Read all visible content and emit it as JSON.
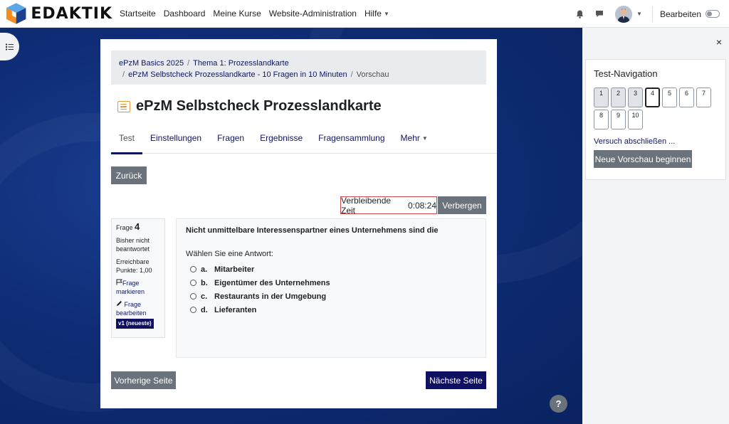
{
  "brand": {
    "name": "EDAKTIK"
  },
  "topnav": {
    "items": [
      "Startseite",
      "Dashboard",
      "Meine Kurse",
      "Website-Administration"
    ],
    "help": "Hilfe",
    "edit_label": "Bearbeiten"
  },
  "breadcrumb": {
    "items": [
      "ePzM Basics 2025",
      "Thema 1: Prozesslandkarte",
      "ePzM Selbstcheck Prozesslandkarte - 10 Fragen in 10 Minuten"
    ],
    "current": "Vorschau"
  },
  "page_title": "ePzM Selbstcheck Prozesslandkarte",
  "tabs": [
    "Test",
    "Einstellungen",
    "Fragen",
    "Ergebnisse",
    "Fragensammlung",
    "Mehr"
  ],
  "buttons": {
    "back": "Zurück",
    "hide": "Verbergen",
    "previous_page": "Vorherige Seite",
    "next_page": "Nächste Seite",
    "new_preview": "Neue Vorschau beginnen"
  },
  "timer": {
    "label": "Verbleibende Zeit",
    "value": "0:08:24"
  },
  "question_info": {
    "label": "Frage",
    "number": "4",
    "status": "Bisher nicht beantwortet",
    "points": "Erreichbare Punkte: 1,00",
    "flag": "Frage markieren",
    "edit": "Frage bearbeiten",
    "version": "v1 (neueste)"
  },
  "question": {
    "text": "Nicht unmittelbare Interessenspartner eines Unternehmens sind die",
    "prompt": "Wählen Sie eine Antwort:",
    "answers": [
      {
        "letter": "a.",
        "text": "Mitarbeiter"
      },
      {
        "letter": "b.",
        "text": "Eigentümer des Unternehmens"
      },
      {
        "letter": "c.",
        "text": "Restaurants in der Umgebung"
      },
      {
        "letter": "d.",
        "text": "Lieferanten"
      }
    ]
  },
  "test_navigation": {
    "title": "Test-Navigation",
    "questions": [
      "1",
      "2",
      "3",
      "4",
      "5",
      "6",
      "7",
      "8",
      "9",
      "10"
    ],
    "finish": "Versuch abschließen ...",
    "close": "×"
  },
  "help_label": "?",
  "colors": {
    "primary": "#0f1062",
    "secondary": "#6a737b",
    "timer_border": "#c84a4a",
    "icon_orange": "#e49b3b"
  }
}
